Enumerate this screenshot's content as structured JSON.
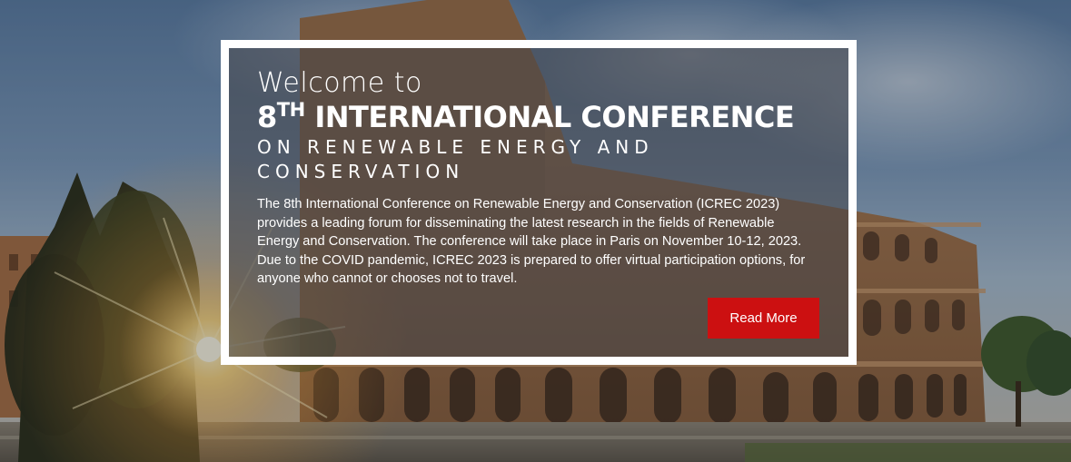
{
  "hero": {
    "welcome": "Welcome to",
    "title_number": "8",
    "title_sup": "TH",
    "title_rest": " INTERNATIONAL CONFERENCE",
    "subtitle": "ON RENEWABLE ENERGY AND CONSERVATION",
    "description": "The 8th International Conference on Renewable Energy and Conservation (ICREC 2023) provides a leading forum for disseminating the latest research in the fields of Renewable Energy and Conservation. The conference will take place in Paris on November 10-12, 2023. Due to the COVID pandemic, ICREC 2023 is prepared to offer virtual participation options, for anyone who cannot or chooses not to travel.",
    "button_label": "Read More"
  },
  "colors": {
    "button": "#cc1011",
    "frame_border": "#ffffff",
    "text": "#ffffff"
  }
}
